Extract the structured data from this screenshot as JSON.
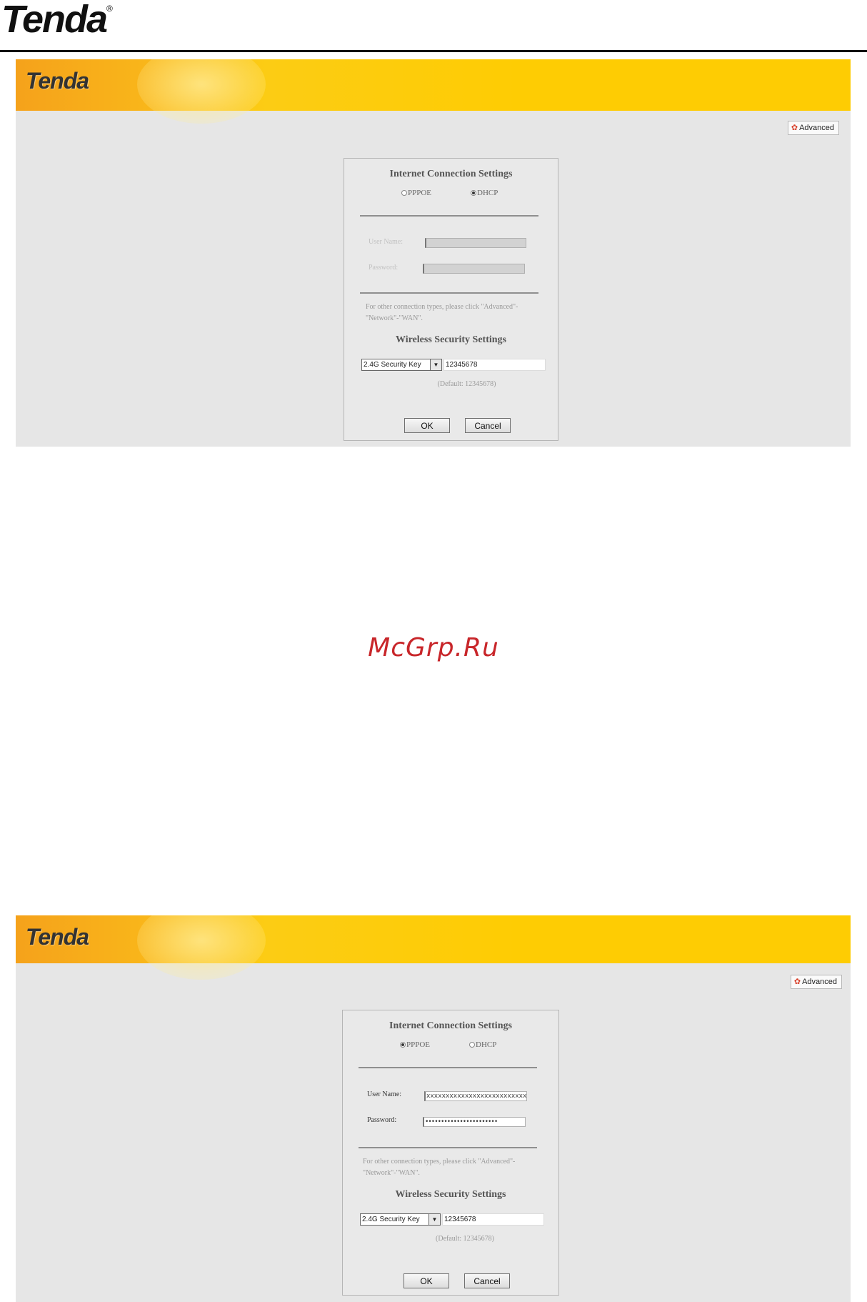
{
  "doc_header": {
    "logo": "Tenda",
    "registered": "®"
  },
  "watermark": "McGrp.Ru",
  "screens": [
    {
      "banner_logo": "Tenda",
      "advanced_label": "Advanced",
      "dialog": {
        "title": "Internet Connection Settings",
        "radio_pppoe": "PPPOE",
        "radio_dhcp": "DHCP",
        "selected": "DHCP",
        "user_name_label": "User Name:",
        "user_name_value": "",
        "password_label": "Password:",
        "password_value": "",
        "note": "For other connection types, please click \"Advanced\"-\"Network\"-\"WAN\".",
        "wireless_title": "Wireless Security Settings",
        "security_select": "2.4G Security Key",
        "security_value": "12345678",
        "default_hint": "(Default: 12345678)",
        "ok_label": "OK",
        "cancel_label": "Cancel"
      }
    },
    {
      "banner_logo": "Tenda",
      "advanced_label": "Advanced",
      "dialog": {
        "title": "Internet Connection Settings",
        "radio_pppoe": "PPPOE",
        "radio_dhcp": "DHCP",
        "selected": "PPPOE",
        "user_name_label": "User Name:",
        "user_name_value": "xxxxxxxxxxxxxxxxxxxxxxxxxxxxxxx",
        "password_label": "Password:",
        "password_value": "•••••••••••••••••••••••",
        "note": "For other connection types, please click \"Advanced\"-\"Network\"-\"WAN\".",
        "wireless_title": "Wireless Security Settings",
        "security_select": "2.4G Security Key",
        "security_value": "12345678",
        "default_hint": "(Default: 12345678)",
        "ok_label": "OK",
        "cancel_label": "Cancel"
      }
    }
  ]
}
